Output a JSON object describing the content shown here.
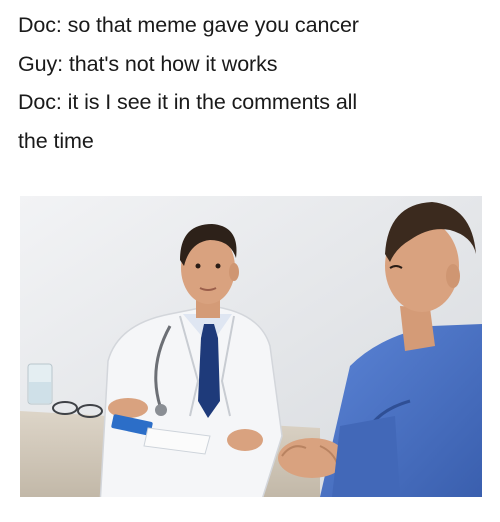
{
  "caption": {
    "lines": [
      "Doc: so that meme gave you cancer",
      "Guy: that's not how it works",
      "Doc: it is I see it in the comments all",
      "the time"
    ]
  },
  "photo": {
    "scene": "doctor-patient-consultation",
    "palette": {
      "background": "#e6e8eb",
      "desk": "#cfc6b8",
      "doctor_coat": "#f4f5f7",
      "doctor_tie": "#1e3a7a",
      "patient_shirt": "#4a72c4",
      "skin": "#d9a27f",
      "hair": "#3b2a1e"
    }
  }
}
